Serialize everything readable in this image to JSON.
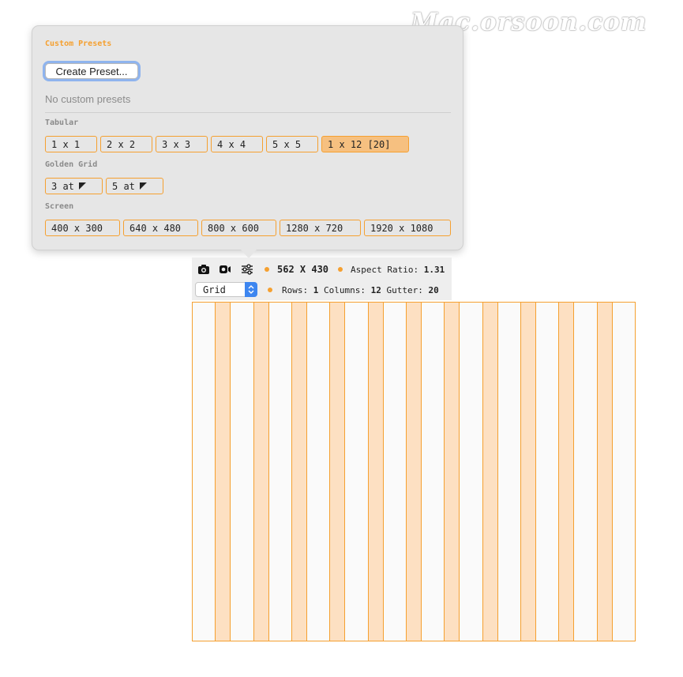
{
  "watermark": "Mac.orsoon.com",
  "presets": {
    "custom_title": "Custom Presets",
    "create_label": "Create Preset...",
    "empty_text": "No custom presets",
    "tabular": {
      "title": "Tabular",
      "items": [
        "1 x 1",
        "2 x 2",
        "3 x 3",
        "4 x 4",
        "5 x 5",
        "1 x 12 [20]"
      ],
      "selected": "1 x 12 [20]"
    },
    "golden": {
      "title": "Golden Grid",
      "items": [
        "3 at",
        "5 at"
      ]
    },
    "screen": {
      "title": "Screen",
      "items": [
        "400 x 300",
        "640 x 480",
        "800 x 600",
        "1280 x 720",
        "1920 x 1080"
      ]
    }
  },
  "toolbar": {
    "icons": [
      "camera-icon",
      "video-icon",
      "sliders-icon",
      "corner-arrow-icon",
      "stepper-icon"
    ],
    "size": "562 X 430",
    "aspect_label": "Aspect Ratio:",
    "aspect_value": "1.31",
    "mode": "Grid",
    "rows_label": "Rows:",
    "rows_value": "1",
    "columns_label": "Columns:",
    "columns_value": "12",
    "gutter_label": "Gutter:",
    "gutter_value": "20"
  },
  "grid": {
    "rows": 1,
    "columns": 12,
    "gutter": 20,
    "width": 562,
    "height": 430
  },
  "colors": {
    "accent": "#f5a030",
    "selected_fill": "#f6c080",
    "gutter_fill": "#fde0c2",
    "stepper_blue": "#3d86f0"
  }
}
